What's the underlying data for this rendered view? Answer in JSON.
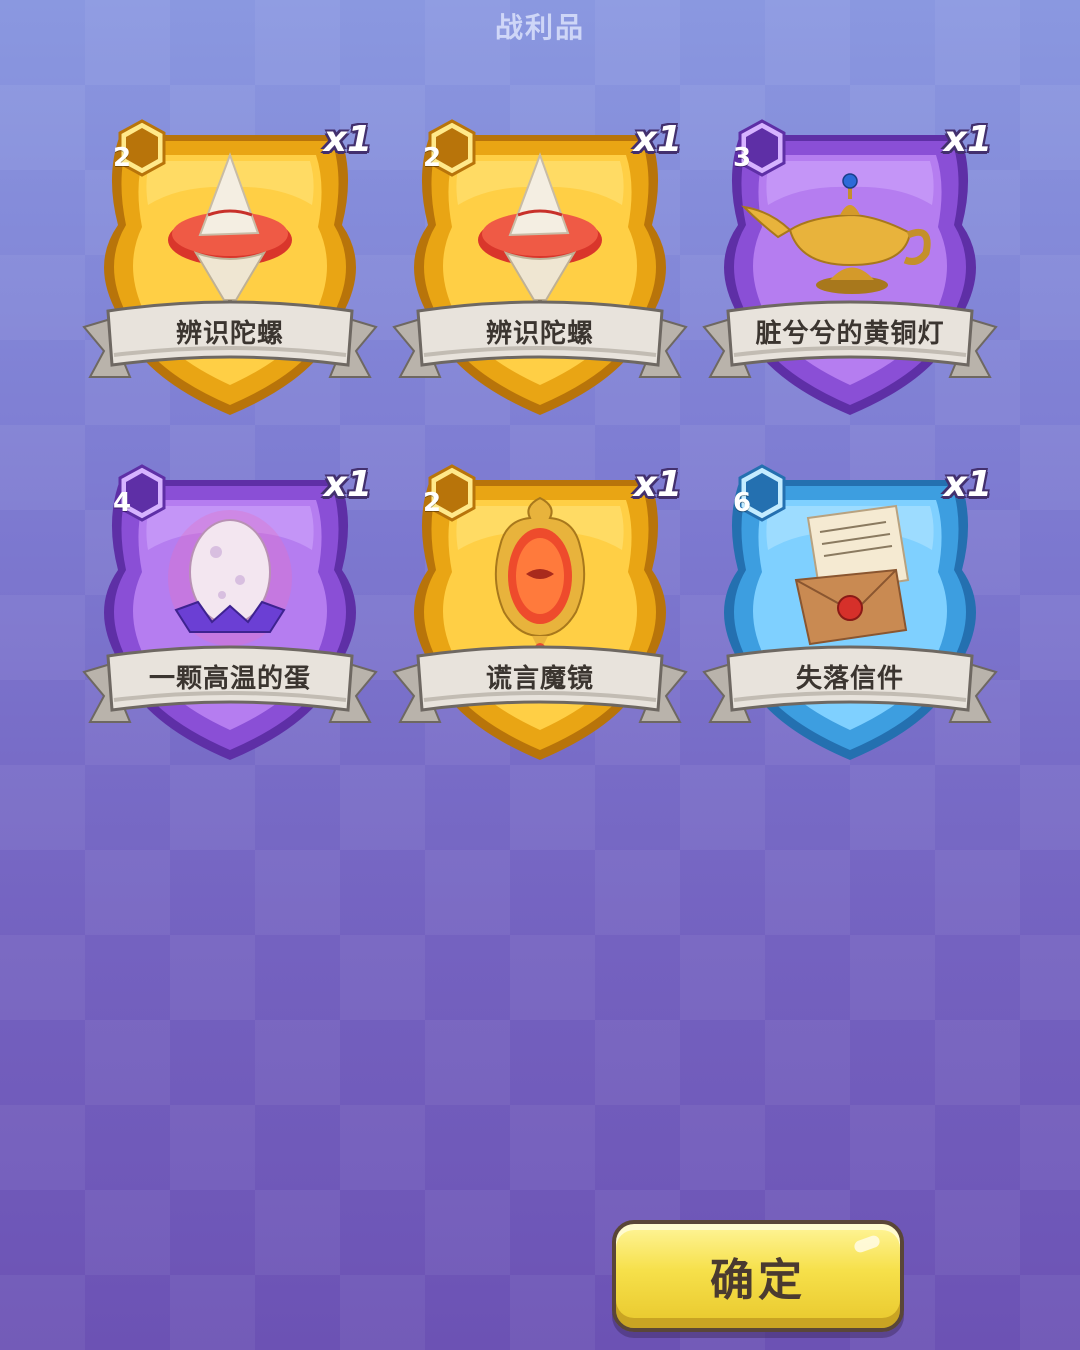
{
  "title": "战利品",
  "items": [
    {
      "rank": "2",
      "qty": "x1",
      "name": "辨识陀螺",
      "tier": "gold",
      "icon": "spinning-top-icon"
    },
    {
      "rank": "2",
      "qty": "x1",
      "name": "辨识陀螺",
      "tier": "gold",
      "icon": "spinning-top-icon"
    },
    {
      "rank": "3",
      "qty": "x1",
      "name": "脏兮兮的黄铜灯",
      "tier": "purple",
      "icon": "brass-lamp-icon"
    },
    {
      "rank": "4",
      "qty": "x1",
      "name": "一颗高温的蛋",
      "tier": "purple",
      "icon": "egg-icon"
    },
    {
      "rank": "2",
      "qty": "x1",
      "name": "谎言魔镜",
      "tier": "gold",
      "icon": "magic-mirror-icon"
    },
    {
      "rank": "6",
      "qty": "x1",
      "name": "失落信件",
      "tier": "blue",
      "icon": "letter-icon"
    }
  ],
  "tier_colors": {
    "gold": {
      "outer": "#e9a514",
      "inner": "#ffcf45",
      "light": "#ffe98a",
      "dark": "#b8740a"
    },
    "purple": {
      "outer": "#8a4fd6",
      "inner": "#b57df0",
      "light": "#d6b3ff",
      "dark": "#5e2fa6"
    },
    "blue": {
      "outer": "#3d9ee0",
      "inner": "#7fd0ff",
      "light": "#c4ecff",
      "dark": "#2470b0"
    }
  },
  "confirm_label": "确定"
}
